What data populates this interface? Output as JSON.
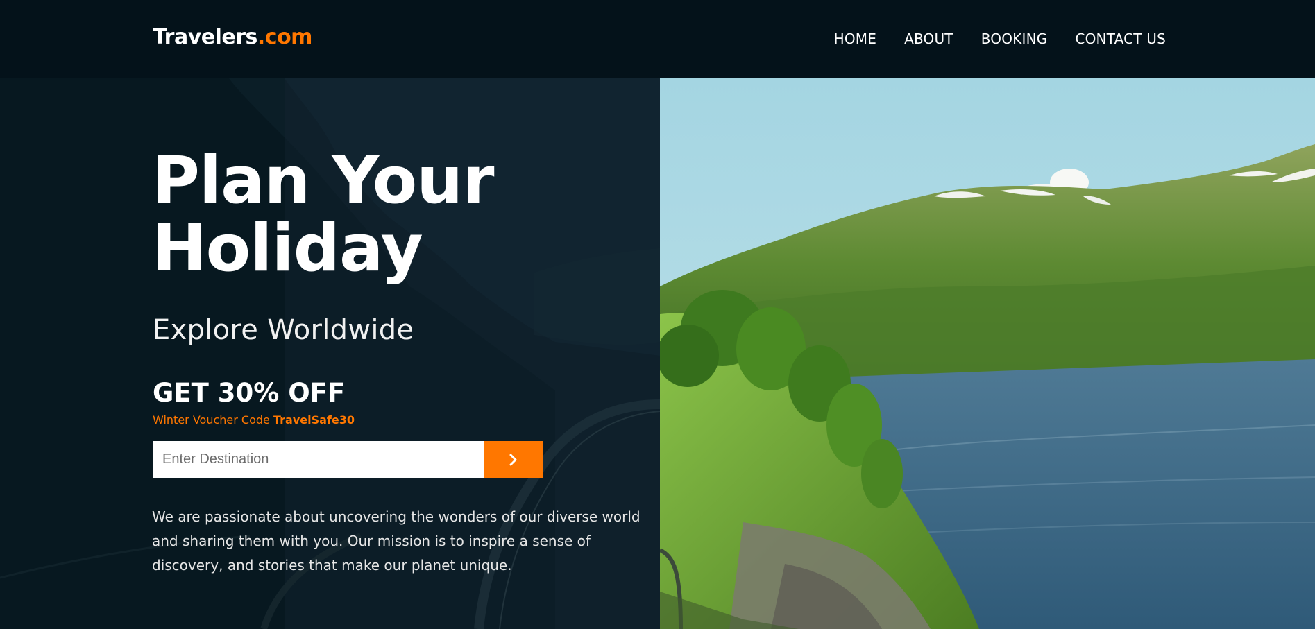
{
  "brand": {
    "name": "Travelers",
    "suffix": ".com",
    "accent_color": "#ff7700"
  },
  "nav": {
    "items": [
      {
        "label": "HOME"
      },
      {
        "label": "ABOUT"
      },
      {
        "label": "BOOKING"
      },
      {
        "label": "CONTACT US"
      }
    ]
  },
  "hero": {
    "title_line1": "Plan Your",
    "title_line2": "Holiday",
    "subtitle": "Explore Worldwide",
    "offer": "GET 30% OFF",
    "voucher_prefix": "Winter Voucher Code ",
    "voucher_code": "TravelSafe30",
    "search_placeholder": "Enter Destination",
    "search_icon": "chevron-right-icon",
    "description": "We are passionate about uncovering the wonders of our diverse world and sharing them with you. Our mission is to inspire a sense of discovery, and stories that make our planet unique."
  },
  "colors": {
    "background": "#04121a",
    "accent": "#ff7700",
    "panel": "#0b1e27"
  }
}
